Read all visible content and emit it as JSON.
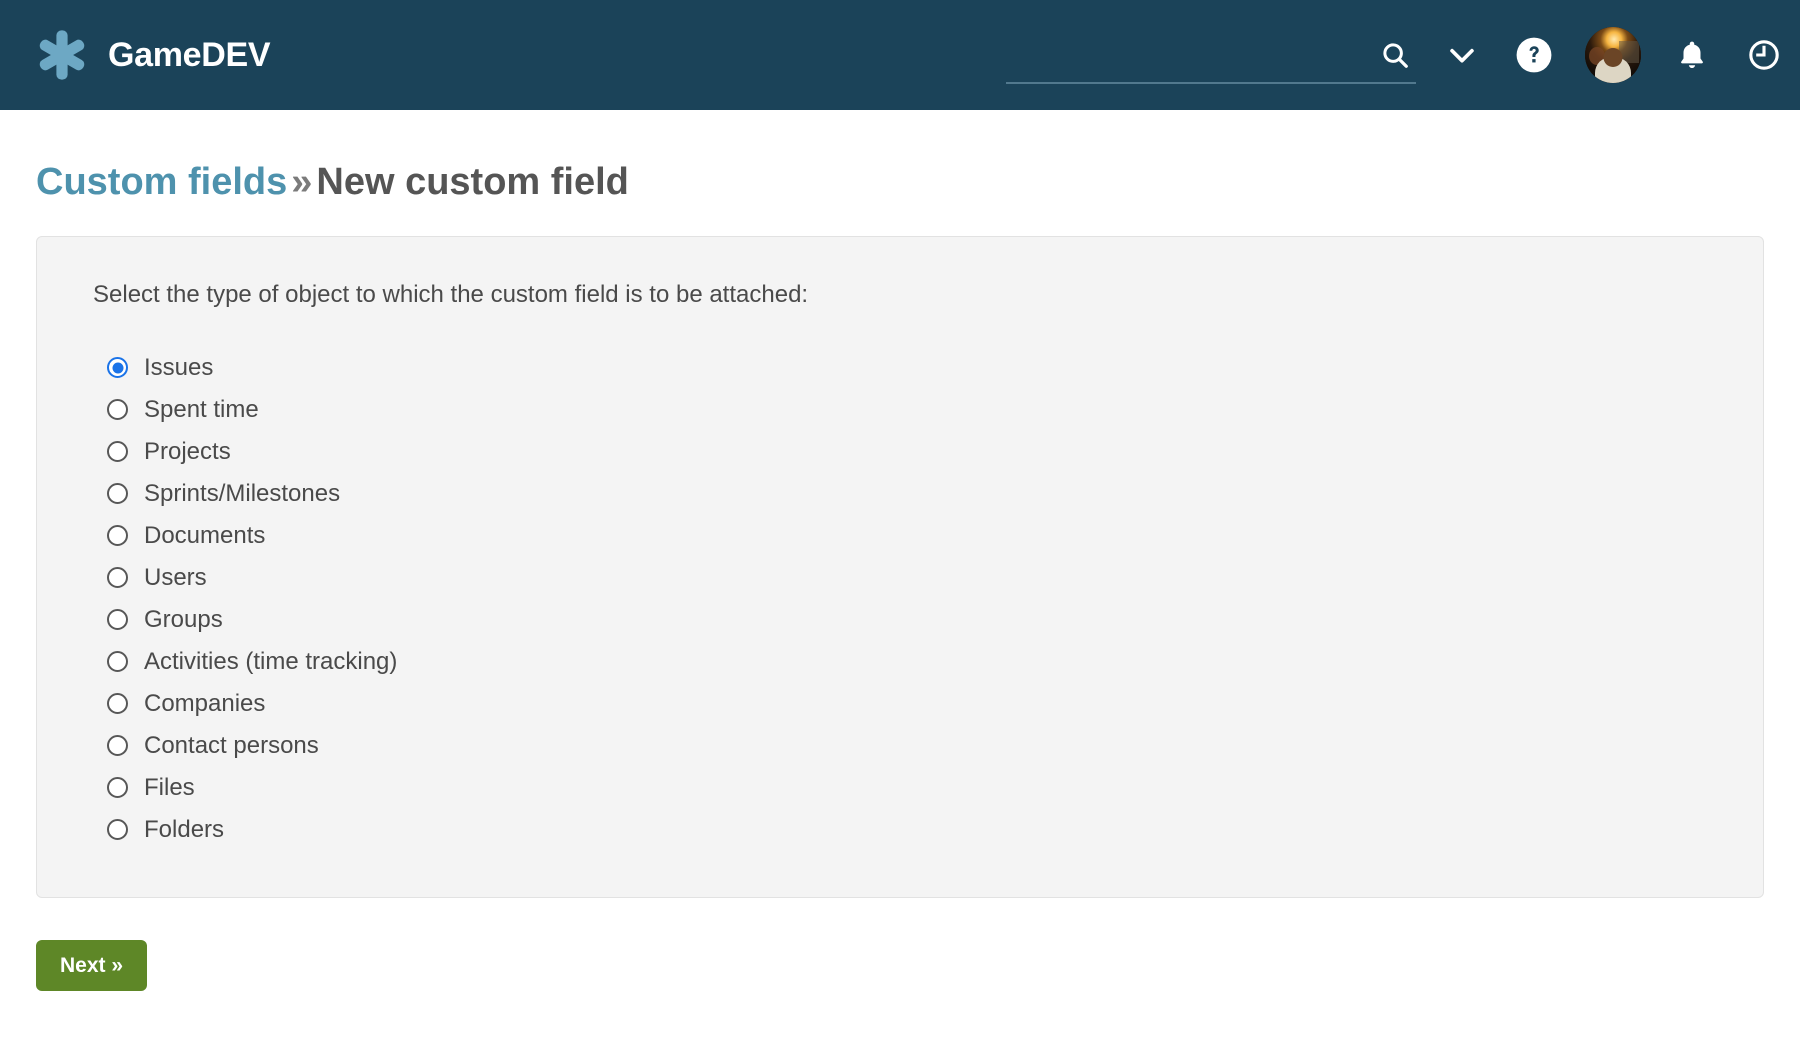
{
  "header": {
    "brand_name": "GameDEV",
    "logo_icon": "asterisk-flower-icon",
    "logo_color": "#6da8c4",
    "background_color": "#1b4359",
    "search": {
      "value": "",
      "placeholder": "",
      "icon": "search-icon"
    },
    "icons": [
      {
        "name": "chevron-down-icon",
        "label": ""
      },
      {
        "name": "help-circle-icon",
        "label": "?"
      },
      {
        "name": "avatar",
        "label": ""
      },
      {
        "name": "bell-icon",
        "label": ""
      },
      {
        "name": "clock-icon",
        "label": ""
      }
    ]
  },
  "breadcrumb": {
    "parent_label": "Custom fields",
    "separator": "»",
    "current_label": "New custom field",
    "link_color": "#4e92ad"
  },
  "panel": {
    "prompt": "Select the type of object to which the custom field is to be attached:",
    "background_color": "#f4f4f4",
    "options": [
      {
        "label": "Issues",
        "checked": true
      },
      {
        "label": "Spent time",
        "checked": false
      },
      {
        "label": "Projects",
        "checked": false
      },
      {
        "label": "Sprints/Milestones",
        "checked": false
      },
      {
        "label": "Documents",
        "checked": false
      },
      {
        "label": "Users",
        "checked": false
      },
      {
        "label": "Groups",
        "checked": false
      },
      {
        "label": "Activities (time tracking)",
        "checked": false
      },
      {
        "label": "Companies",
        "checked": false
      },
      {
        "label": "Contact persons",
        "checked": false
      },
      {
        "label": "Files",
        "checked": false
      },
      {
        "label": "Folders",
        "checked": false
      }
    ],
    "selected_value": "Issues",
    "accent_color": "#1a73e8"
  },
  "actions": {
    "next_label": "Next »",
    "next_color": "#5e8727"
  }
}
